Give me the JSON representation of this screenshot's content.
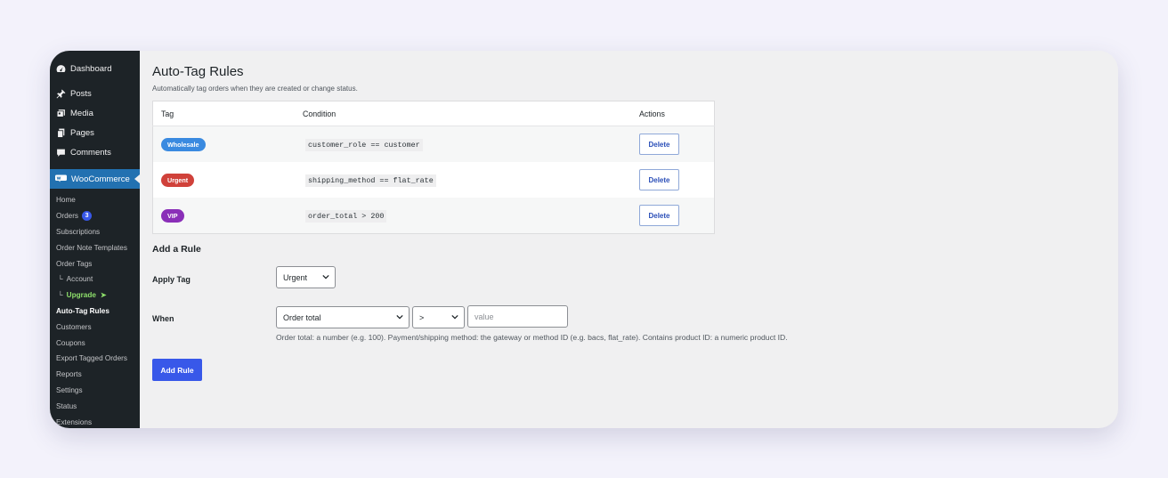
{
  "sidebar": {
    "top_items": [
      {
        "label": "Dashboard",
        "icon": "dashboard-icon"
      },
      {
        "label": "Posts",
        "icon": "pin-icon"
      },
      {
        "label": "Media",
        "icon": "media-icon"
      },
      {
        "label": "Pages",
        "icon": "pages-icon"
      },
      {
        "label": "Comments",
        "icon": "comment-icon"
      }
    ],
    "woocommerce": {
      "label": "WooCommerce",
      "icon": "woocommerce-icon"
    },
    "submenu": [
      {
        "label": "Home"
      },
      {
        "label": "Orders",
        "badge": "3"
      },
      {
        "label": "Subscriptions"
      },
      {
        "label": "Order Note Templates"
      },
      {
        "label": "Order Tags"
      },
      {
        "label": "Account",
        "prefix": "└"
      },
      {
        "label": "Upgrade",
        "prefix": "└",
        "suffix": "➤"
      },
      {
        "label": "Auto-Tag Rules"
      },
      {
        "label": "Customers"
      },
      {
        "label": "Coupons"
      },
      {
        "label": "Export Tagged Orders"
      },
      {
        "label": "Reports"
      },
      {
        "label": "Settings"
      },
      {
        "label": "Status"
      },
      {
        "label": "Extensions"
      }
    ]
  },
  "page": {
    "title": "Auto-Tag Rules",
    "subtitle": "Automatically tag orders when they are created or change status."
  },
  "rules_table": {
    "headers": {
      "tag": "Tag",
      "condition": "Condition",
      "actions": "Actions"
    },
    "rows": [
      {
        "tag": "Wholesale",
        "tag_color": "#3a8ae0",
        "condition": "customer_role == customer",
        "action": "Delete"
      },
      {
        "tag": "Urgent",
        "tag_color": "#d0413a",
        "condition": "shipping_method == flat_rate",
        "action": "Delete"
      },
      {
        "tag": "VIP",
        "tag_color": "#8a2fb8",
        "condition": "order_total > 200",
        "action": "Delete"
      }
    ]
  },
  "add_rule": {
    "heading": "Add a Rule",
    "apply_tag_label": "Apply Tag",
    "apply_tag_value": "Urgent",
    "when_label": "When",
    "field_value": "Order total",
    "operator_value": ">",
    "value_placeholder": "value",
    "help_text": "Order total: a number (e.g. 100). Payment/shipping method: the gateway or method ID (e.g. bacs, flat_rate). Contains product ID: a numeric product ID.",
    "submit_label": "Add Rule"
  },
  "colors": {
    "sidebar_bg": "#1d2327",
    "woo_active": "#2271b1",
    "accent": "#3858e9",
    "upgrade": "#8ee06b"
  }
}
